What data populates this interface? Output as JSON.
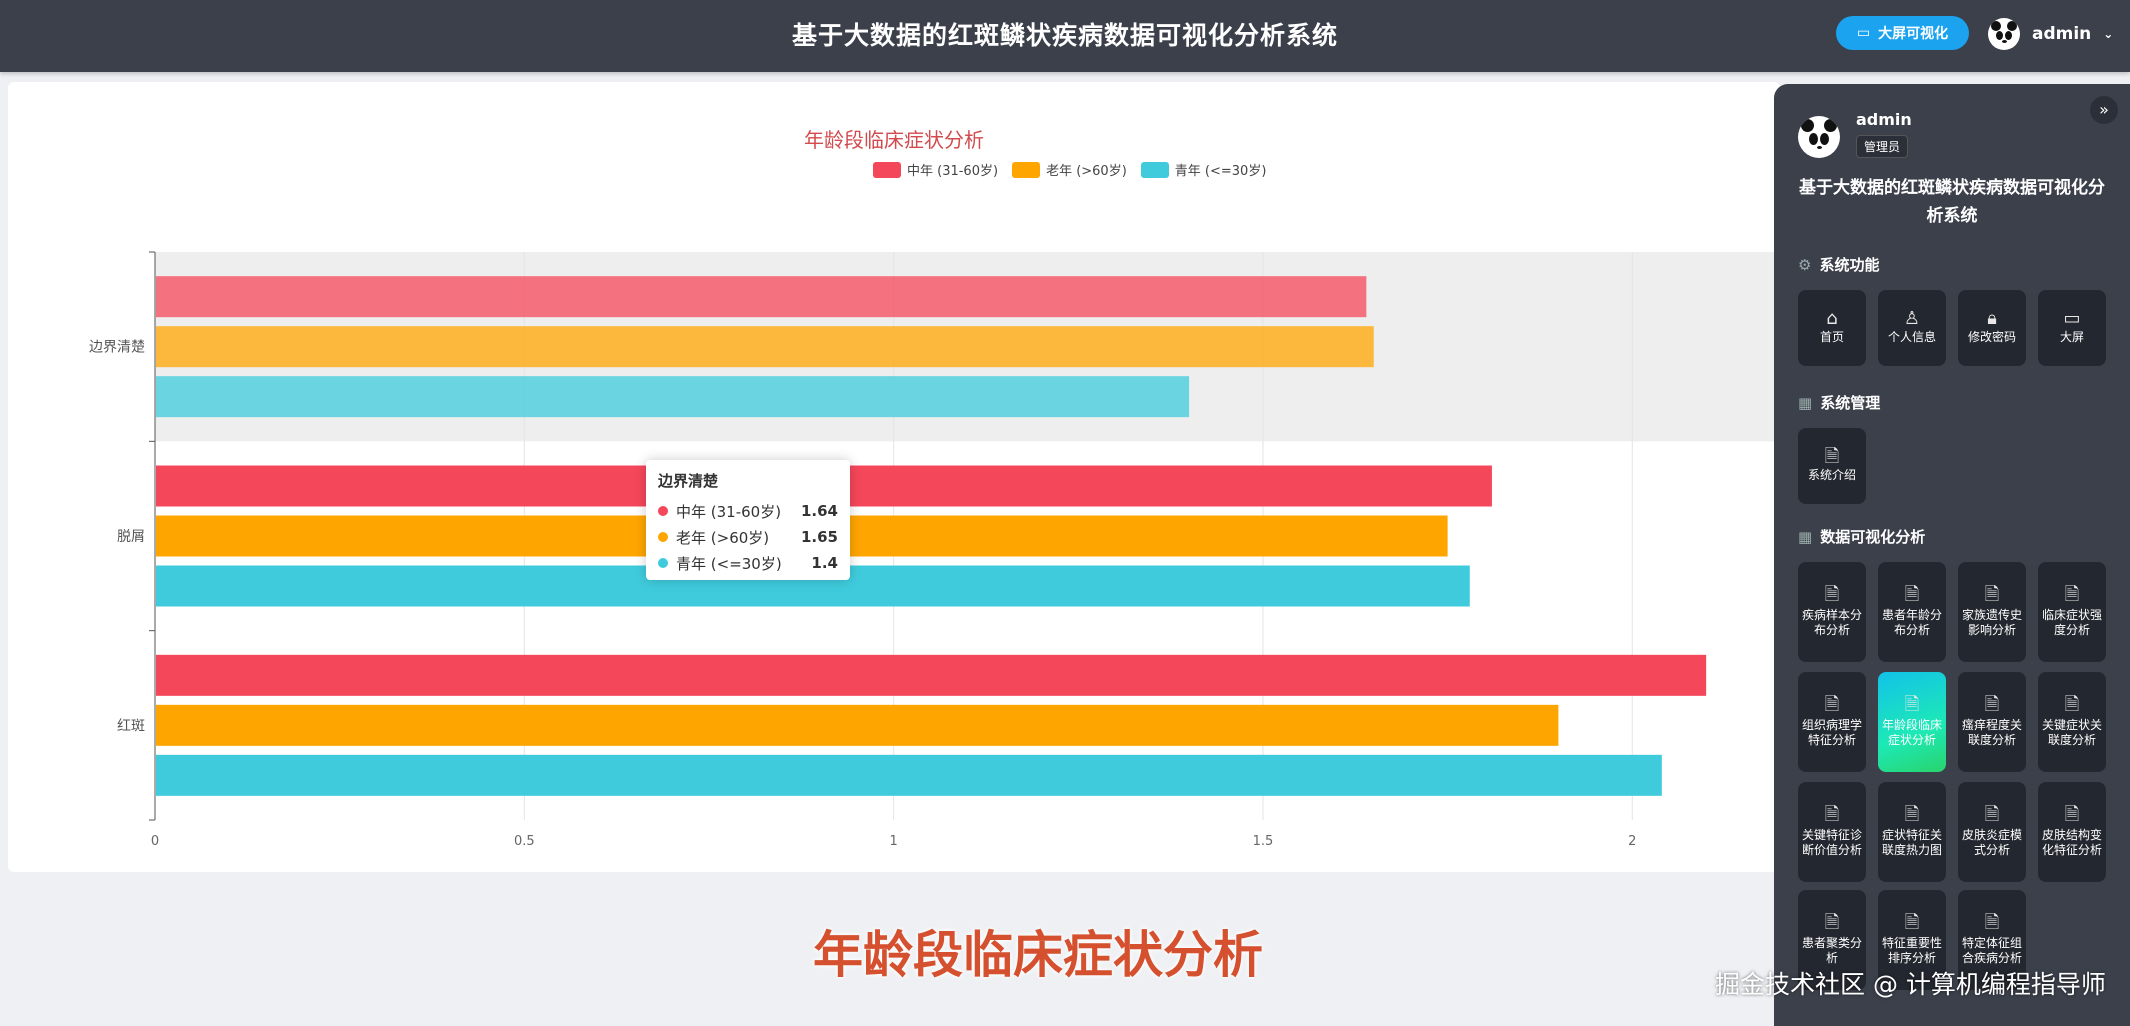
{
  "header": {
    "title": "基于大数据的红斑鳞状疾病数据可视化分析系统",
    "bigscreen_label": "大屏可视化",
    "user": "admin",
    "dropdown_icon": "chevron-down-icon"
  },
  "chart_data": {
    "type": "bar",
    "orientation": "horizontal",
    "title": "年龄段临床症状分析",
    "categories": [
      "边界清楚",
      "脱屑",
      "红斑"
    ],
    "series": [
      {
        "name": "中年 (31-60岁)",
        "color": "#f5475a",
        "values": [
          1.64,
          1.81,
          2.1
        ]
      },
      {
        "name": "老年 (>60岁)",
        "color": "#ffa500",
        "values": [
          1.65,
          1.75,
          1.9
        ]
      },
      {
        "name": "青年 (<=30岁)",
        "color": "#3fcbdc",
        "values": [
          1.4,
          1.78,
          2.04
        ]
      }
    ],
    "xlim": [
      0,
      2.2
    ],
    "xticks": [
      "0",
      "0.5",
      "1",
      "1.5",
      "2"
    ],
    "grid": true,
    "legend_position": "top-center",
    "highlighted_category": "边界清楚"
  },
  "tooltip": {
    "title": "边界清楚",
    "rows": [
      {
        "name": "中年 (31-60岁)",
        "value": "1.64",
        "color": "#f5475a"
      },
      {
        "name": "老年 (>60岁)",
        "value": "1.65",
        "color": "#ffa500"
      },
      {
        "name": "青年 (<=30岁)",
        "value": "1.4",
        "color": "#3fcbdc"
      }
    ]
  },
  "caption": "年龄段临床症状分析",
  "watermark": "掘金技术社区 @ 计算机编程指导师",
  "panel": {
    "user": "admin",
    "role": "管理员",
    "title": "基于大数据的红斑鳞状疾病数据可视化分析系统",
    "sections": [
      {
        "title": "系统功能",
        "icon": "gear-icon"
      },
      {
        "title": "系统管理",
        "icon": "grid-icon"
      },
      {
        "title": "数据可视化分析",
        "icon": "grid-icon"
      }
    ],
    "functions": [
      {
        "label": "首页",
        "icon": "home-icon"
      },
      {
        "label": "个人信息",
        "icon": "user-icon"
      },
      {
        "label": "修改密码",
        "icon": "lock-icon"
      },
      {
        "label": "大屏",
        "icon": "screen-icon"
      }
    ],
    "management": [
      {
        "label": "系统介绍",
        "icon": "document-icon"
      }
    ],
    "analysis": [
      {
        "label": "疾病样本分布分析"
      },
      {
        "label": "患者年龄分布分析"
      },
      {
        "label": "家族遗传史影响分析"
      },
      {
        "label": "临床症状强度分析"
      },
      {
        "label": "组织病理学特征分析"
      },
      {
        "label": "年龄段临床症状分析",
        "active": true
      },
      {
        "label": "瘙痒程度关联度分析"
      },
      {
        "label": "关键症状关联度分析"
      },
      {
        "label": "关键特征诊断价值分析"
      },
      {
        "label": "症状特征关联度热力图"
      },
      {
        "label": "皮肤炎症模式分析"
      },
      {
        "label": "皮肤结构变化特征分析"
      },
      {
        "label": "患者聚类分析"
      },
      {
        "label": "特征重要性排序分析"
      },
      {
        "label": "特定体征组合疾病分析"
      }
    ]
  }
}
